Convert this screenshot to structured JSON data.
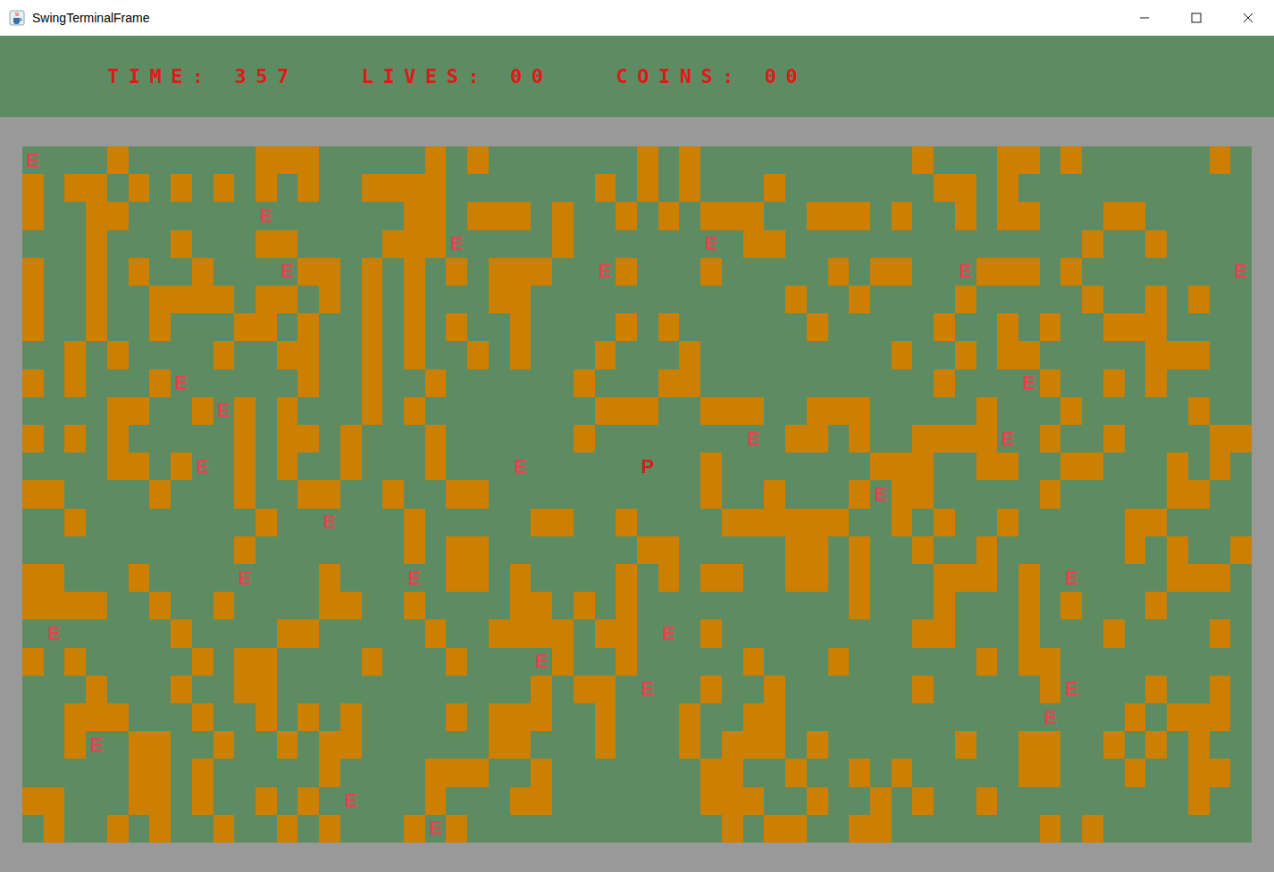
{
  "window": {
    "title": "SwingTerminalFrame"
  },
  "hud": [
    {
      "text": "TIME: 357"
    },
    {
      "text": "LIVES: 00"
    },
    {
      "text": "COINS: 00"
    }
  ],
  "map": {
    "legend": {
      "wall": "#",
      "floor": "."
    },
    "glyphs": [
      {
        "char": "E",
        "color": "#e8414f"
      },
      {
        "char": "P",
        "color": "#d81b1b"
      }
    ],
    "rows": [
      "E...#......###.....#.#.......#.#..........#...##.#......#.",
      "#.##.#.#.#.#.#..####.......#.#.#...#.......##.#...........",
      "#..##......E......##.###.#..#.#.###..###.#..#.##...##......",
      "...#...#...##....###E....#......E.##..............#..#....#.",
      "#..#.#..#...E##.#.#.#.###..E#...#.....#.##..E###.#.......E",
      "#..#..####.##.#.#.#...##............#..#....#.....#..#.#..",
      "#..#..#...##.#..#.#.#..#....#.#......#.....#..#.#..###....",
      "..#.#....#..##..#.#..#.#...#...#.........#..#.##.....###..",
      "#.#...#E.....#..#..#......#...##...........#...E#..#.#....",
      "....##..#E#.#...#.#........###..###..###.....#...#.....#..",
      "#.#.#.....#.##.#...#......#.......E.##.#..####E.#..#....##",
      "....##.#E.#.#..#...#...E.....P..#.......###..##..##...#.#.",
      "##....#...#..##..#..##..........#..#...#E##.....#.....##..",
      "..#........#..E...#.....##..#....######..#.#..#.....##....",
      "..........#.......#.##.......##.....##.#..#..#......#.#..#",
      "##...#....E...#...E.##.#....#.#.##..##.#...###.#.E....###.",
      "####..#..#....##..#....##.#.#..........#...#...#.#...#....",
      ".E.....#....##.....#..####.##.E.#.........##...#...#....#.",
      "#.#.....#.##....#...#...E#..#.....#...#......#.##.........",
      "...#...#..##............#.##.E..#..#......#.....#E...#..#.",
      "..###...#..#.#.#....#.###..#...#..##............E...#.###.",
      "..#E.##..#..#.##......##...#...#.###.#......#..##..#.#.#..",
      ".....##.#.....#....###..#.......##..#..#.#.....##...#..##.",
      "##...##.#..#.#.E...#...##.......###..#..#.#..#.........#..",
      ".#..#.#..#..#.#...#E#............#.##..##.......#.#......."
    ]
  }
}
